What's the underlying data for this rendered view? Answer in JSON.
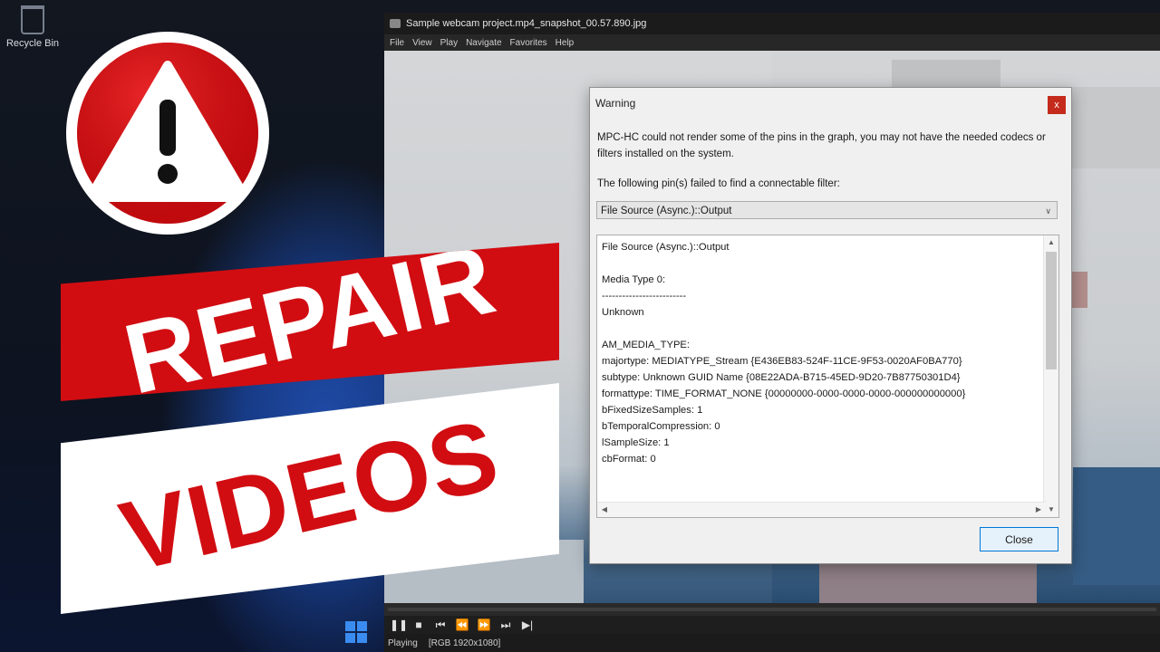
{
  "desktop": {
    "recycle_bin_label": "Recycle Bin"
  },
  "player": {
    "title": "Sample webcam project.mp4_snapshot_00.57.890.jpg",
    "menu": [
      "File",
      "View",
      "Play",
      "Navigate",
      "Favorites",
      "Help"
    ],
    "status_text": "Playing",
    "status_format": "[RGB 1920x1080]"
  },
  "dialog": {
    "title": "Warning",
    "close_x": "x",
    "message": "MPC-HC could not render some of the pins in the graph, you may not have the needed codecs or filters installed on the system.",
    "failed_label": "The following pin(s) failed to find a connectable filter:",
    "selected_pin": "File Source (Async.)::Output",
    "details": "File Source (Async.)::Output\n\nMedia Type 0:\n-------------------------\nUnknown\n\nAM_MEDIA_TYPE:\nmajortype: MEDIATYPE_Stream {E436EB83-524F-11CE-9F53-0020AF0BA770}\nsubtype: Unknown GUID Name {08E22ADA-B715-45ED-9D20-7B87750301D4}\nformattype: TIME_FORMAT_NONE {00000000-0000-0000-0000-000000000000}\nbFixedSizeSamples: 1\nbTemporalCompression: 0\nlSampleSize: 1\ncbFormat: 0",
    "close_button": "Close"
  },
  "overlay": {
    "line1": "REPAIR",
    "line2": "VIDEOS",
    "accent_red": "#d10d12",
    "icon": "warning-icon"
  },
  "controls": {
    "icons": [
      "pause-icon",
      "stop-icon",
      "previous-icon",
      "rewind-icon",
      "fast-forward-icon",
      "next-icon",
      "frame-step-icon"
    ]
  }
}
